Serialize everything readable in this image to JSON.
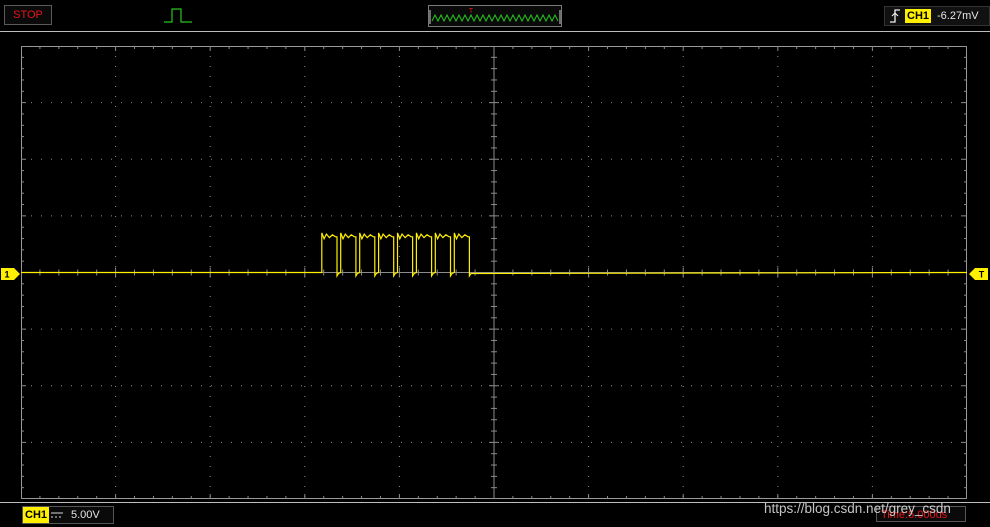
{
  "toolbar": {
    "run_state_label": "STOP",
    "trigger_mode_icon": "single-pulse-icon",
    "timebase_preview_marker": "T",
    "trigger_edge_icon": "rising-edge-icon",
    "trigger_channel": "CH1",
    "trigger_level": "-6.27mV"
  },
  "screen": {
    "ch1_marker_label": "1",
    "trigger_marker_label": "T"
  },
  "status_bar": {
    "channel_label": "CH1",
    "coupling_icon": "dc-coupling-icon",
    "volts_per_div": "5.00V",
    "time_per_div": "Time:5.000us"
  },
  "watermark": "https://blog.csdn.net/grey_csdn",
  "colors": {
    "trace": "#ffef00",
    "grid": "#8c8c8c",
    "stop": "#e8141a",
    "preview_wave": "#26c41f"
  },
  "chart_data": {
    "type": "line",
    "title": "",
    "xlabel": "",
    "ylabel": "",
    "grid": true,
    "divisions_x": 10,
    "divisions_y": 8,
    "xlim": [
      -25,
      25
    ],
    "ylim": [
      -20,
      20
    ],
    "x_unit": "us",
    "y_unit": "V",
    "series": [
      {
        "channel": "CH1",
        "baseline": 0,
        "pulse_high": 3.5,
        "undershoot": -0.3,
        "pulses": [
          {
            "start": -9.1,
            "end": -8.3
          },
          {
            "start": -8.1,
            "end": -7.3
          },
          {
            "start": -7.1,
            "end": -6.3
          },
          {
            "start": -6.1,
            "end": -5.3
          },
          {
            "start": -5.1,
            "end": -4.3
          },
          {
            "start": -4.1,
            "end": -3.3
          },
          {
            "start": -3.1,
            "end": -2.3
          },
          {
            "start": -2.1,
            "end": -1.3
          }
        ]
      }
    ]
  }
}
